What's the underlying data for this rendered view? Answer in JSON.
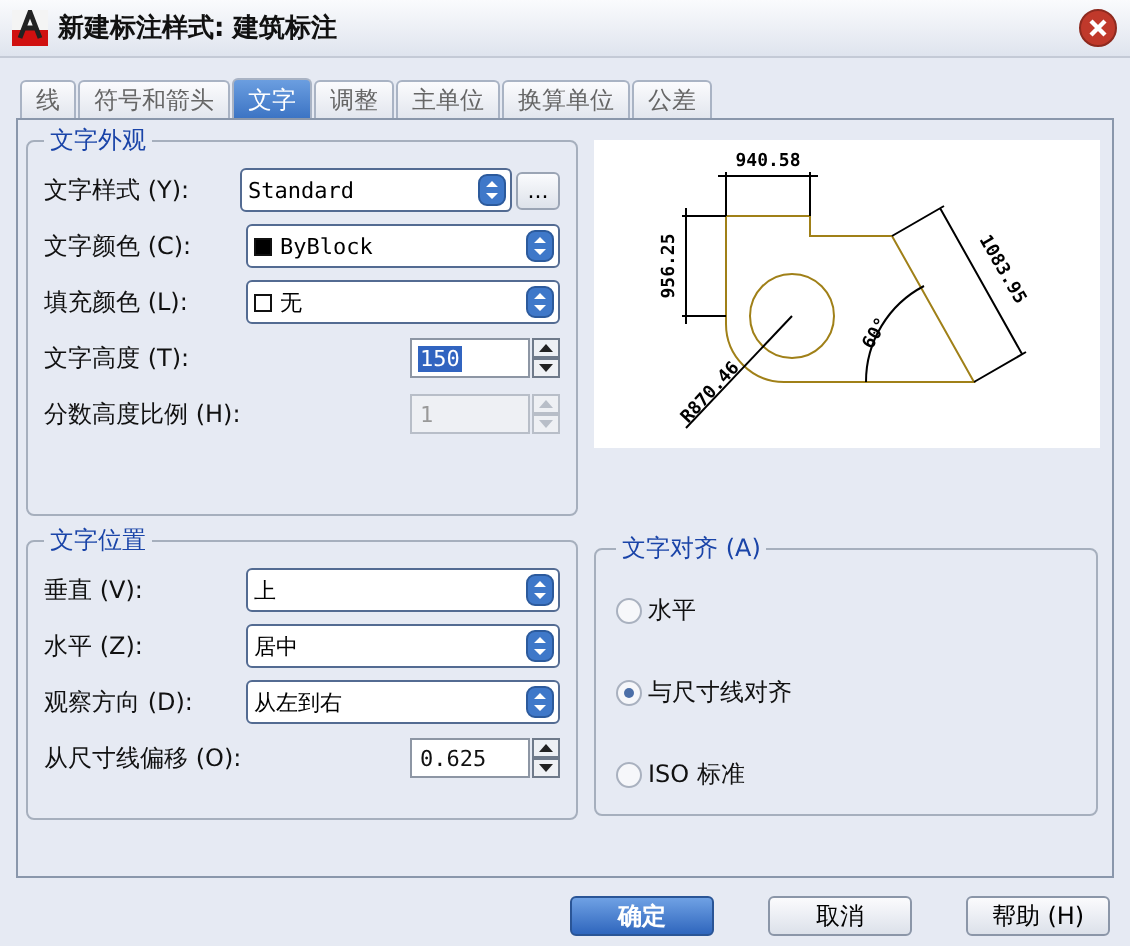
{
  "window": {
    "title": "新建标注样式: 建筑标注"
  },
  "tabs": [
    {
      "label": "线",
      "selected": false
    },
    {
      "label": "符号和箭头",
      "selected": false
    },
    {
      "label": "文字",
      "selected": true
    },
    {
      "label": "调整",
      "selected": false
    },
    {
      "label": "主单位",
      "selected": false
    },
    {
      "label": "换算单位",
      "selected": false
    },
    {
      "label": "公差",
      "selected": false
    }
  ],
  "text_appearance": {
    "title": "文字外观",
    "rows": [
      {
        "kind": "select",
        "label": "文字样式 (Y):",
        "value": "Standard",
        "browse": "..."
      },
      {
        "kind": "select",
        "label": "文字颜色 (C):",
        "value": "ByBlock",
        "swatch_filled": true
      },
      {
        "kind": "select",
        "label": "填充颜色 (L):",
        "value": "无",
        "swatch_filled": false
      },
      {
        "kind": "spin",
        "label": "文字高度 (T):",
        "value": "150",
        "highlighted": true,
        "disabled": false
      },
      {
        "kind": "spin",
        "label": "分数高度比例 (H):",
        "value": "1",
        "highlighted": false,
        "disabled": true
      }
    ]
  },
  "preview": {
    "labels": [
      "940.58",
      "956.25",
      "1083.95",
      "60°",
      "R870.46"
    ]
  },
  "text_placement": {
    "title": "文字位置",
    "rows": [
      {
        "kind": "select",
        "label": "垂直 (V):",
        "value": "上"
      },
      {
        "kind": "select",
        "label": "水平 (Z):",
        "value": "居中"
      },
      {
        "kind": "select",
        "label": "观察方向 (D):",
        "value": "从左到右"
      },
      {
        "kind": "spin",
        "label": "从尺寸线偏移 (O):",
        "value": "0.625",
        "highlighted": false,
        "disabled": false
      }
    ]
  },
  "text_alignment": {
    "title": "文字对齐 (A)",
    "options": [
      {
        "label": "水平",
        "selected": false
      },
      {
        "label": "与尺寸线对齐",
        "selected": true
      },
      {
        "label": "ISO 标准",
        "selected": false
      }
    ]
  },
  "buttons": [
    {
      "label": "确定",
      "primary": true
    },
    {
      "label": "取消",
      "primary": false
    },
    {
      "label": "帮助 (H)",
      "primary": false
    }
  ]
}
